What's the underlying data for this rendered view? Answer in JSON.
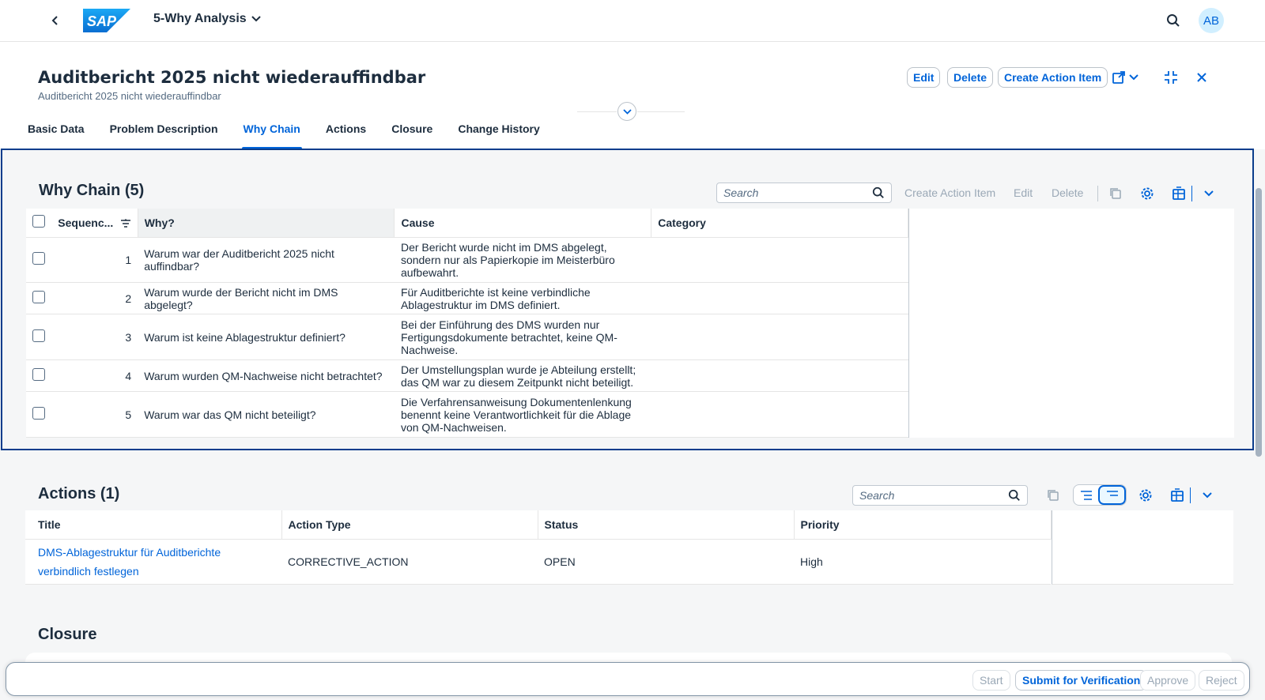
{
  "shell": {
    "app_title": "5-Why Analysis",
    "avatar_initials": "AB",
    "logo_text": "SAP"
  },
  "header": {
    "title": "Auditbericht 2025 nicht wiederauffindbar",
    "subtitle": "Auditbericht 2025 nicht wiederauffindbar",
    "edit_label": "Edit",
    "delete_label": "Delete",
    "create_action_label": "Create Action Item"
  },
  "tabs": [
    "Basic Data",
    "Problem Description",
    "Why Chain",
    "Actions",
    "Closure",
    "Change History"
  ],
  "why_chain": {
    "title": "Why Chain (5)",
    "search_placeholder": "Search",
    "toolbar": {
      "create_action_label": "Create Action Item",
      "edit_label": "Edit",
      "delete_label": "Delete"
    },
    "columns": [
      "Sequenc...",
      "Why?",
      "Cause",
      "Category"
    ],
    "rows": [
      {
        "seq": "1",
        "why": "Warum war der Auditbericht 2025 nicht auffindbar?",
        "cause": "Der Bericht wurde nicht im DMS abgelegt, sondern nur als Papierkopie im Meisterbüro aufbewahrt.",
        "category": ""
      },
      {
        "seq": "2",
        "why": "Warum wurde der Bericht nicht im DMS abgelegt?",
        "cause": "Für Auditberichte ist keine verbindliche Ablagestruktur im DMS definiert.",
        "category": ""
      },
      {
        "seq": "3",
        "why": "Warum ist keine Ablagestruktur definiert?",
        "cause": "Bei der Einführung des DMS wurden nur Fertigungsdokumente betrachtet, keine QM-Nachweise.",
        "category": ""
      },
      {
        "seq": "4",
        "why": "Warum wurden QM-Nachweise nicht betrachtet?",
        "cause": "Der Umstellungsplan wurde je Abteilung erstellt; das QM war zu diesem Zeitpunkt nicht beteiligt.",
        "category": ""
      },
      {
        "seq": "5",
        "why": "Warum war das QM nicht beteiligt?",
        "cause": "Die Verfahrensanweisung Dokumentenlenkung benennt keine Verantwortlichkeit für die Ablage von QM-Nachweisen.",
        "category": ""
      }
    ]
  },
  "actions": {
    "title": "Actions (1)",
    "search_placeholder": "Search",
    "columns": [
      "Title",
      "Action Type",
      "Status",
      "Priority"
    ],
    "rows": [
      {
        "title": "DMS-Ablagestruktur für Auditberichte verbindlich festlegen",
        "type": "CORRECTIVE_ACTION",
        "status": "OPEN",
        "priority": "High"
      }
    ]
  },
  "closure": {
    "title": "Closure"
  },
  "footer": {
    "start_label": "Start",
    "submit_label": "Submit for Verification",
    "approve_label": "Approve",
    "reject_label": "Reject"
  },
  "colors": {
    "accent": "#0064d9",
    "focus_border": "#0a3d8c",
    "disabled_text": "#9aa8b6"
  }
}
